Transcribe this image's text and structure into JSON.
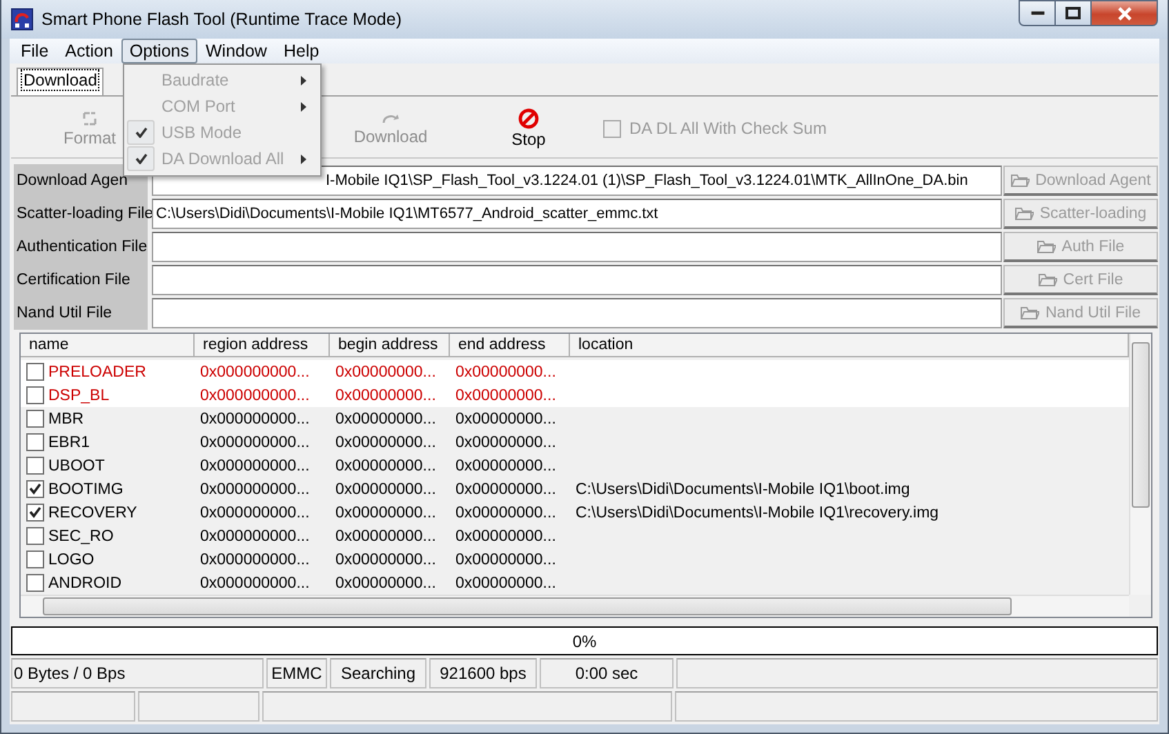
{
  "window": {
    "title": "Smart Phone Flash Tool (Runtime Trace Mode)"
  },
  "menu_bar": [
    {
      "label": "File",
      "selected": false
    },
    {
      "label": "Action",
      "selected": false
    },
    {
      "label": "Options",
      "selected": true
    },
    {
      "label": "Window",
      "selected": false
    },
    {
      "label": "Help",
      "selected": false
    }
  ],
  "open_menu": [
    {
      "label": "Baudrate",
      "checked": false,
      "submenu": true,
      "disabled": true
    },
    {
      "label": "COM Port",
      "checked": false,
      "submenu": true,
      "disabled": true
    },
    {
      "label": "USB Mode",
      "checked": true,
      "submenu": false,
      "disabled": true
    },
    {
      "label": "DA Download All",
      "checked": true,
      "submenu": true,
      "disabled": true
    }
  ],
  "tabs": [
    {
      "label": "Download",
      "selected": true
    }
  ],
  "toolbar": {
    "buttons": [
      {
        "label": "Format",
        "kind": "format",
        "disabled": true
      },
      {
        "label": "Download",
        "kind": "download",
        "disabled": true
      },
      {
        "label": "Stop",
        "kind": "stop",
        "disabled": false
      }
    ],
    "checksum": {
      "label": "DA DL All With Check Sum",
      "checked": false,
      "disabled": true
    }
  },
  "files": [
    {
      "label": "Download Agen",
      "value": "I-Mobile IQ1\\SP_Flash_Tool_v3.1224.01 (1)\\SP_Flash_Tool_v3.1224.01\\MTK_AllInOne_DA.bin",
      "button": "Download Agent"
    },
    {
      "label": "Scatter-loading File",
      "value": "C:\\Users\\Didi\\Documents\\I-Mobile IQ1\\MT6577_Android_scatter_emmc.txt",
      "button": "Scatter-loading"
    },
    {
      "label": "Authentication File",
      "button": "Auth File"
    },
    {
      "label": "Certification File",
      "button": "Cert File"
    },
    {
      "label": "Nand Util File",
      "button": "Nand Util File"
    }
  ],
  "table": {
    "columns": [
      "name",
      "region address",
      "begin address",
      "end address",
      "location"
    ],
    "rows": [
      {
        "name": "PRELOADER",
        "checked": false,
        "color": "#cc0000",
        "highlighted": true,
        "region": "0x000000000...",
        "begin": "0x00000000...",
        "end": "0x00000000..."
      },
      {
        "name": "DSP_BL",
        "checked": false,
        "color": "#cc0000",
        "highlighted": true,
        "region": "0x000000000...",
        "begin": "0x00000000...",
        "end": "0x00000000..."
      },
      {
        "name": "MBR",
        "checked": false,
        "color": "#000000",
        "highlighted": false,
        "region": "0x000000000...",
        "begin": "0x00000000...",
        "end": "0x00000000..."
      },
      {
        "name": "EBR1",
        "checked": false,
        "color": "#000000",
        "highlighted": false,
        "region": "0x000000000...",
        "begin": "0x00000000...",
        "end": "0x00000000..."
      },
      {
        "name": "UBOOT",
        "checked": false,
        "color": "#000000",
        "highlighted": false,
        "region": "0x000000000...",
        "begin": "0x00000000...",
        "end": "0x00000000..."
      },
      {
        "name": "BOOTIMG",
        "checked": true,
        "color": "#000000",
        "highlighted": false,
        "region": "0x000000000...",
        "begin": "0x00000000...",
        "end": "0x00000000...",
        "location": "C:\\Users\\Didi\\Documents\\I-Mobile IQ1\\boot.img"
      },
      {
        "name": "RECOVERY",
        "checked": true,
        "color": "#000000",
        "highlighted": false,
        "region": "0x000000000...",
        "begin": "0x00000000...",
        "end": "0x00000000...",
        "location": "C:\\Users\\Didi\\Documents\\I-Mobile IQ1\\recovery.img"
      },
      {
        "name": "SEC_RO",
        "checked": false,
        "color": "#000000",
        "highlighted": false,
        "region": "0x000000000...",
        "begin": "0x00000000...",
        "end": "0x00000000..."
      },
      {
        "name": "LOGO",
        "checked": false,
        "color": "#000000",
        "highlighted": false,
        "region": "0x000000000...",
        "begin": "0x00000000...",
        "end": "0x00000000..."
      },
      {
        "name": "ANDROID",
        "checked": false,
        "color": "#000000",
        "highlighted": false,
        "region": "0x000000000...",
        "begin": "0x00000000...",
        "end": "0x00000000..."
      }
    ]
  },
  "progress": {
    "level": 0,
    "text": "0%"
  },
  "status_bar": [
    "0 Bytes / 0 Bps",
    "EMMC",
    "Searching",
    "921600 bps",
    "0:00 sec"
  ]
}
